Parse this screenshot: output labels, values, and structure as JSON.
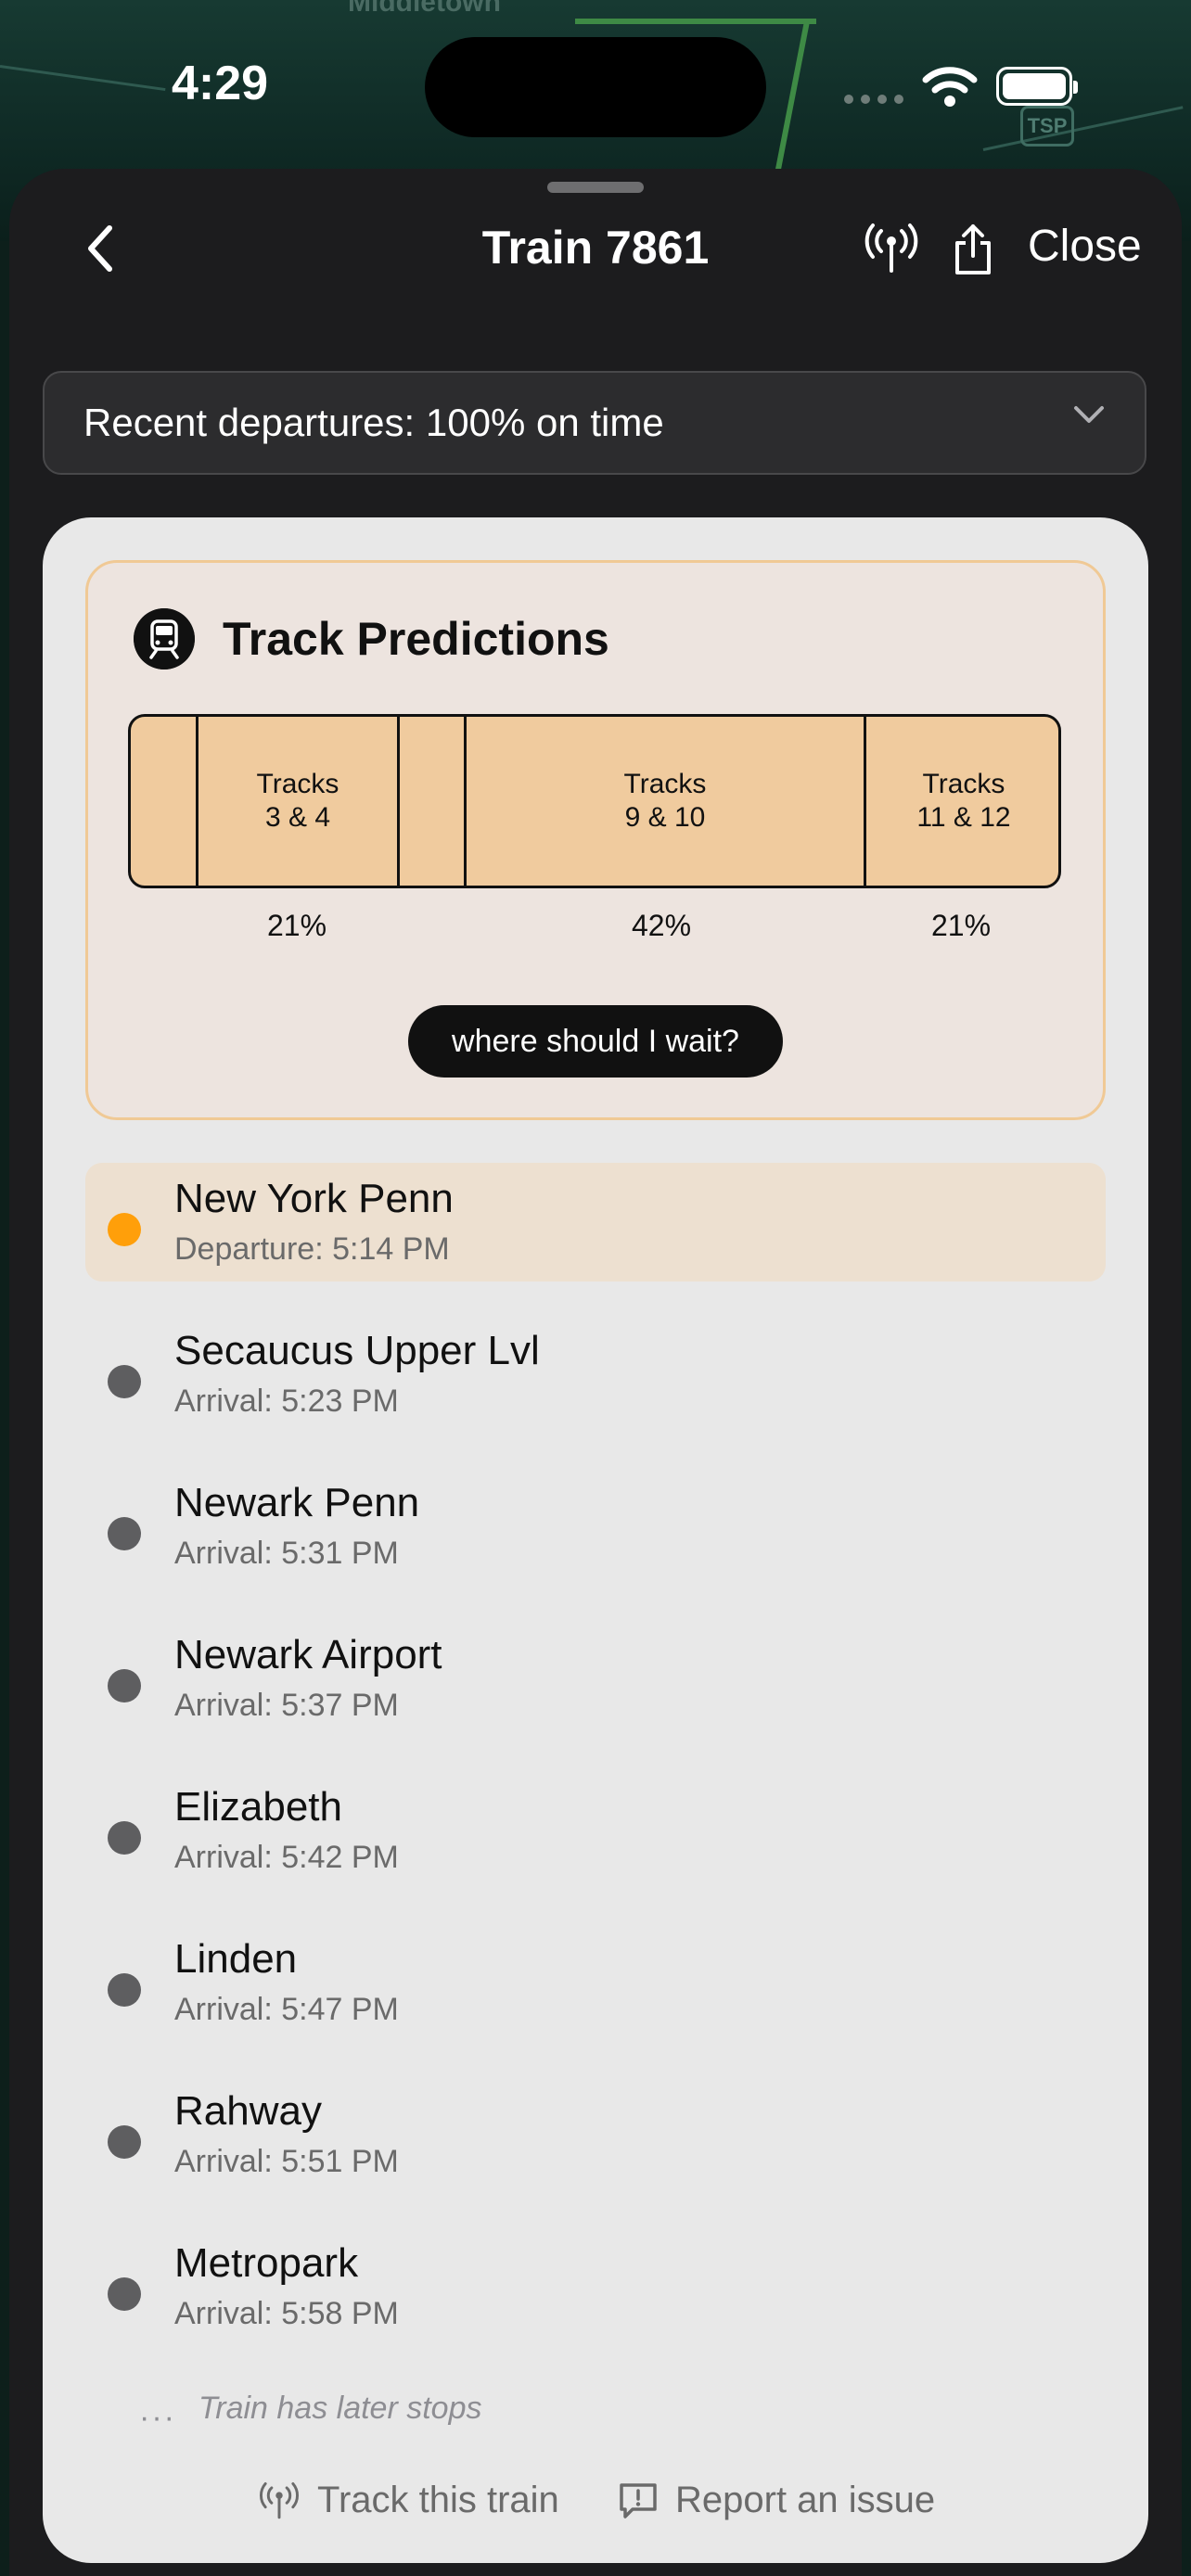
{
  "map": {
    "label": "Middletown",
    "badge": "TSP"
  },
  "status_bar": {
    "time": "4:29"
  },
  "nav": {
    "title": "Train 7861",
    "close_label": "Close"
  },
  "departures": {
    "summary": "Recent departures: 100% on time"
  },
  "predictions": {
    "title": "Track Predictions",
    "segments": [
      {
        "label_line1": "",
        "label_line2": ""
      },
      {
        "label_line1": "Tracks",
        "label_line2": "3 & 4",
        "percent": "21%"
      },
      {
        "label_line1": "",
        "label_line2": ""
      },
      {
        "label_line1": "Tracks",
        "label_line2": "9 & 10",
        "percent": "42%"
      },
      {
        "label_line1": "Tracks",
        "label_line2": "11 & 12",
        "percent": "21%"
      }
    ],
    "wait_button": "where should I wait?"
  },
  "stops": [
    {
      "name": "New York Penn",
      "time": "Departure: 5:14 PM",
      "current": true
    },
    {
      "name": "Secaucus Upper Lvl",
      "time": "Arrival: 5:23 PM"
    },
    {
      "name": "Newark Penn",
      "time": "Arrival: 5:31 PM"
    },
    {
      "name": "Newark Airport",
      "time": "Arrival: 5:37 PM"
    },
    {
      "name": "Elizabeth",
      "time": "Arrival: 5:42 PM"
    },
    {
      "name": "Linden",
      "time": "Arrival: 5:47 PM"
    },
    {
      "name": "Rahway",
      "time": "Arrival: 5:51 PM"
    },
    {
      "name": "Metropark",
      "time": "Arrival: 5:58 PM"
    }
  ],
  "later_stops_note": "Train has later stops",
  "footer": {
    "track_label": "Track this train",
    "report_label": "Report an issue"
  },
  "colors": {
    "current_stop_dot": "#ff9f0a",
    "stop_dot": "#5e5e60",
    "track_fill": "#f0cb9e"
  }
}
